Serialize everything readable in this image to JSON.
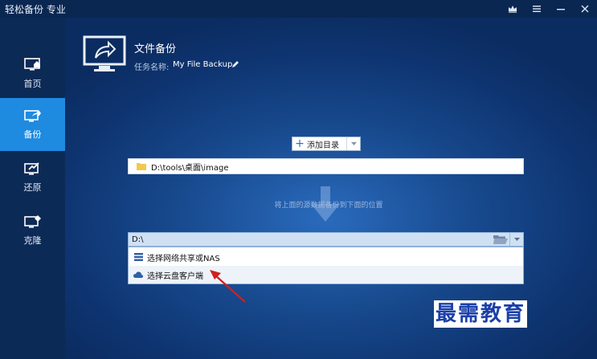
{
  "window": {
    "title": "轻松备份 专业"
  },
  "sidebar": {
    "items": [
      {
        "label": "首页",
        "icon": "home-monitor-icon"
      },
      {
        "label": "备份",
        "icon": "backup-monitor-icon",
        "active": true
      },
      {
        "label": "还原",
        "icon": "restore-monitor-icon"
      },
      {
        "label": "克隆",
        "icon": "clone-monitor-icon"
      }
    ]
  },
  "task": {
    "title": "文件备份",
    "name_label": "任务名称:",
    "name_value": "My File Backup"
  },
  "toolbar": {
    "add_dir_label": "添加目录"
  },
  "source": {
    "path": "D:\\tools\\桌面\\image"
  },
  "hint": "将上面的源数据备份到下面的位置",
  "destination": {
    "path": "D:\\",
    "options": [
      {
        "label": "选择网络共享或NAS",
        "icon": "nas-icon"
      },
      {
        "label": "选择云盘客户端",
        "icon": "cloud-icon"
      }
    ]
  },
  "watermark": "最需教育",
  "colors": {
    "accent": "#1e8ae0",
    "sidebar": "#0c2a56",
    "annotation": "#d21f1f"
  }
}
